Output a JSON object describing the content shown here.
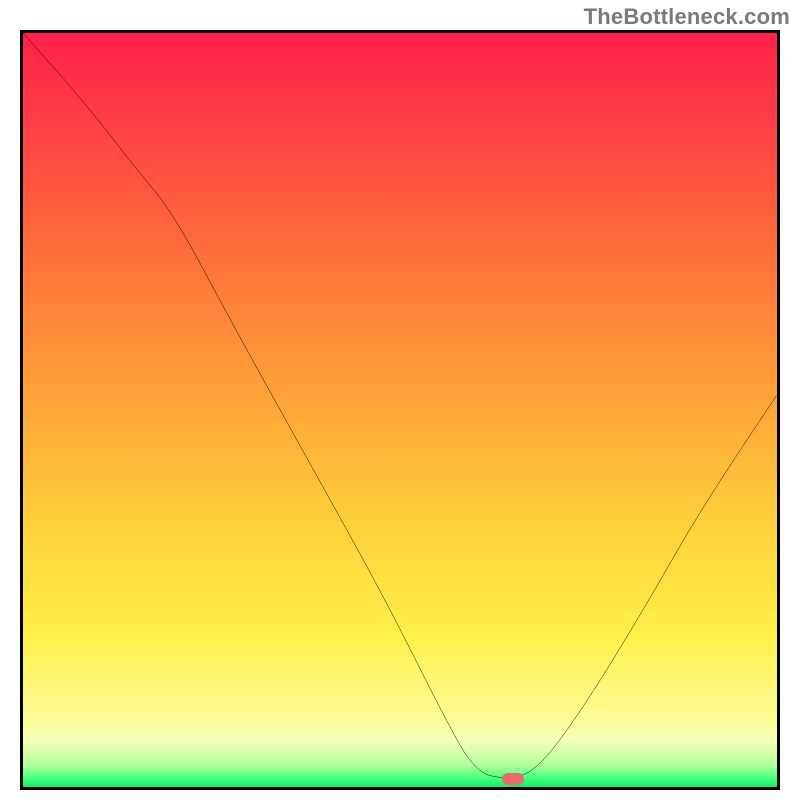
{
  "watermark": "TheBottleneck.com",
  "chart_data": {
    "type": "line",
    "title": "",
    "xlabel": "",
    "ylabel": "",
    "xlim": [
      0,
      100
    ],
    "ylim": [
      0,
      100
    ],
    "grid": false,
    "legend": false,
    "background_gradient": {
      "stops": [
        {
          "pos": 0,
          "color": "#ff1f4b"
        },
        {
          "pos": 10,
          "color": "#ff3a45"
        },
        {
          "pos": 28,
          "color": "#ff6b3c"
        },
        {
          "pos": 48,
          "color": "#ffa238"
        },
        {
          "pos": 66,
          "color": "#ffd23a"
        },
        {
          "pos": 80,
          "color": "#fff04a"
        },
        {
          "pos": 90,
          "color": "#fffb8e"
        },
        {
          "pos": 94,
          "color": "#f1ffb8"
        },
        {
          "pos": 97,
          "color": "#b5ff9c"
        },
        {
          "pos": 99,
          "color": "#3cff7a"
        },
        {
          "pos": 100,
          "color": "#18e86a"
        }
      ]
    },
    "series": [
      {
        "name": "bottleneck-curve",
        "color": "#000000",
        "stroke_width": 3,
        "points_comment": "Values are y (0 = bottom/green, 100 = top/red). Curve descends from top-left, kinks around x≈20, reaches valley floor (y≈1) between x≈60 and x≈68, then rises toward right to y≈52 at x=100.",
        "x": [
          0,
          8,
          15,
          20,
          28,
          38,
          48,
          56,
          60,
          64,
          68,
          74,
          82,
          90,
          100
        ],
        "y": [
          100,
          91,
          82,
          76,
          61,
          43,
          25,
          9,
          2,
          1,
          2,
          10,
          23,
          37,
          52
        ]
      }
    ],
    "marker": {
      "name": "optimal-point",
      "x": 65,
      "y": 1,
      "color": "#e96a6f",
      "shape": "pill"
    }
  }
}
